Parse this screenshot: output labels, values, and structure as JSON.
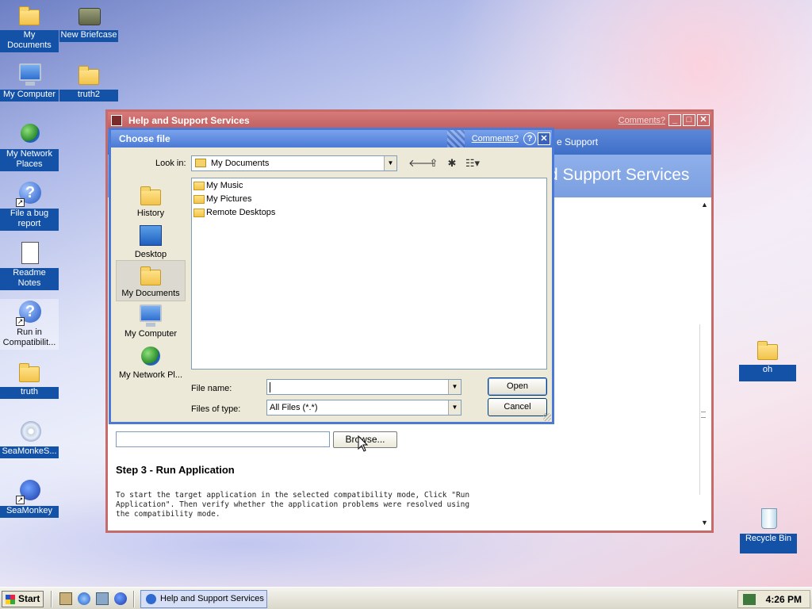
{
  "desktop": {
    "icons": [
      {
        "label": "My Documents"
      },
      {
        "label": "New Briefcase"
      },
      {
        "label": "My Computer"
      },
      {
        "label": "truth2"
      },
      {
        "label": "My Network Places"
      },
      {
        "label": "File a bug report"
      },
      {
        "label": "Readme Notes"
      },
      {
        "label": "Run in Compatibilit..."
      },
      {
        "label": "truth"
      },
      {
        "label": "SeaMonkeS..."
      },
      {
        "label": "SeaMonkey"
      },
      {
        "label": "oh"
      },
      {
        "label": "Recycle Bin"
      }
    ]
  },
  "help_window": {
    "title": "Help and Support Services",
    "comments_link": "Comments?",
    "nav_text": "e Support",
    "banner_text": "d Support Services",
    "browse_label": "Browse...",
    "step_title": "Step 3 - Run Application",
    "step_description": "To start the target application in the selected compatibility mode, Click \"Run Application\". Then verify whether the application problems were resolved using the compatibility mode."
  },
  "dialog": {
    "title": "Choose file",
    "comments_link": "Comments?",
    "help_glyph": "?",
    "close_glyph": "✕",
    "look_in_label": "Look in:",
    "look_in_value": "My Documents",
    "places": [
      {
        "label": "History"
      },
      {
        "label": "Desktop"
      },
      {
        "label": "My Documents"
      },
      {
        "label": "My Computer"
      },
      {
        "label": "My Network Pl..."
      }
    ],
    "files": [
      {
        "name": "My Music"
      },
      {
        "name": "My Pictures"
      },
      {
        "name": "Remote Desktops"
      }
    ],
    "file_name_label": "File name:",
    "file_name_value": "",
    "files_of_type_label": "Files of type:",
    "files_of_type_value": "All Files (*.*)",
    "open_label": "Open",
    "cancel_label": "Cancel"
  },
  "taskbar": {
    "start_label": "Start",
    "task_label": "Help and Support Services",
    "clock": "4:26 PM"
  },
  "colors": {
    "accent": "#4a7ad6",
    "help_window_frame": "#c76a6a",
    "icon_label_bg": "#1452a8"
  }
}
